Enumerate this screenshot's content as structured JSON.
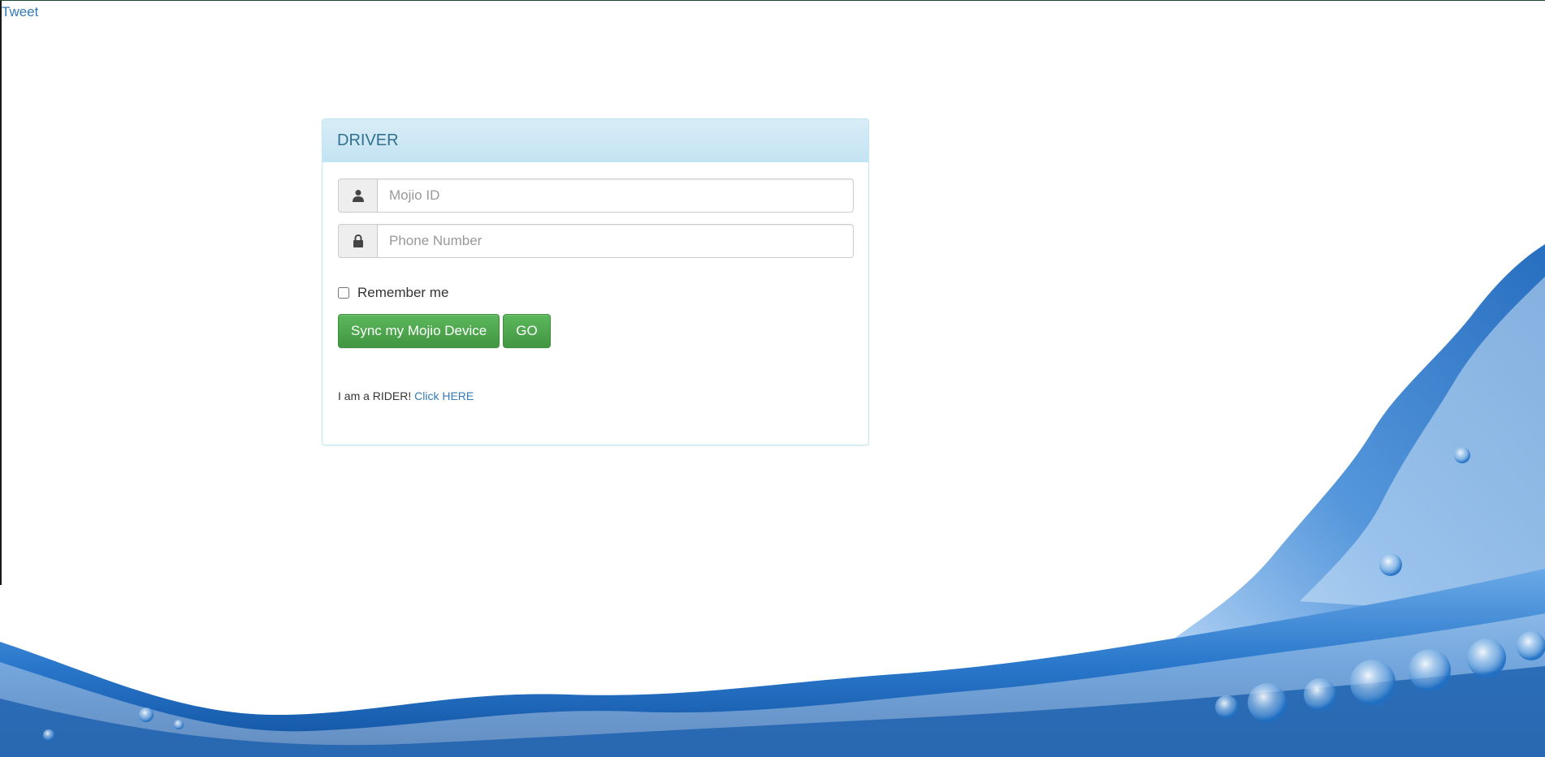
{
  "top_link": {
    "tweet_label": "Tweet"
  },
  "panel": {
    "title": "DRIVER",
    "mojio_field": {
      "placeholder": "Mojio ID",
      "value": "",
      "icon": "user-icon"
    },
    "phone_field": {
      "placeholder": "Phone Number",
      "value": "",
      "icon": "lock-icon"
    },
    "remember": {
      "label": "Remember me",
      "checked": false
    },
    "buttons": {
      "sync_label": "Sync my Mojio Device",
      "go_label": "GO"
    },
    "rider": {
      "text": "I am a RIDER!",
      "link_label": "Click HERE"
    }
  },
  "colors": {
    "panel_heading": "#d9edf7",
    "panel_title": "#31708f",
    "button_green": "#5cb85c",
    "link_blue": "#337ab7",
    "water_blue": "#1f6fc4"
  }
}
